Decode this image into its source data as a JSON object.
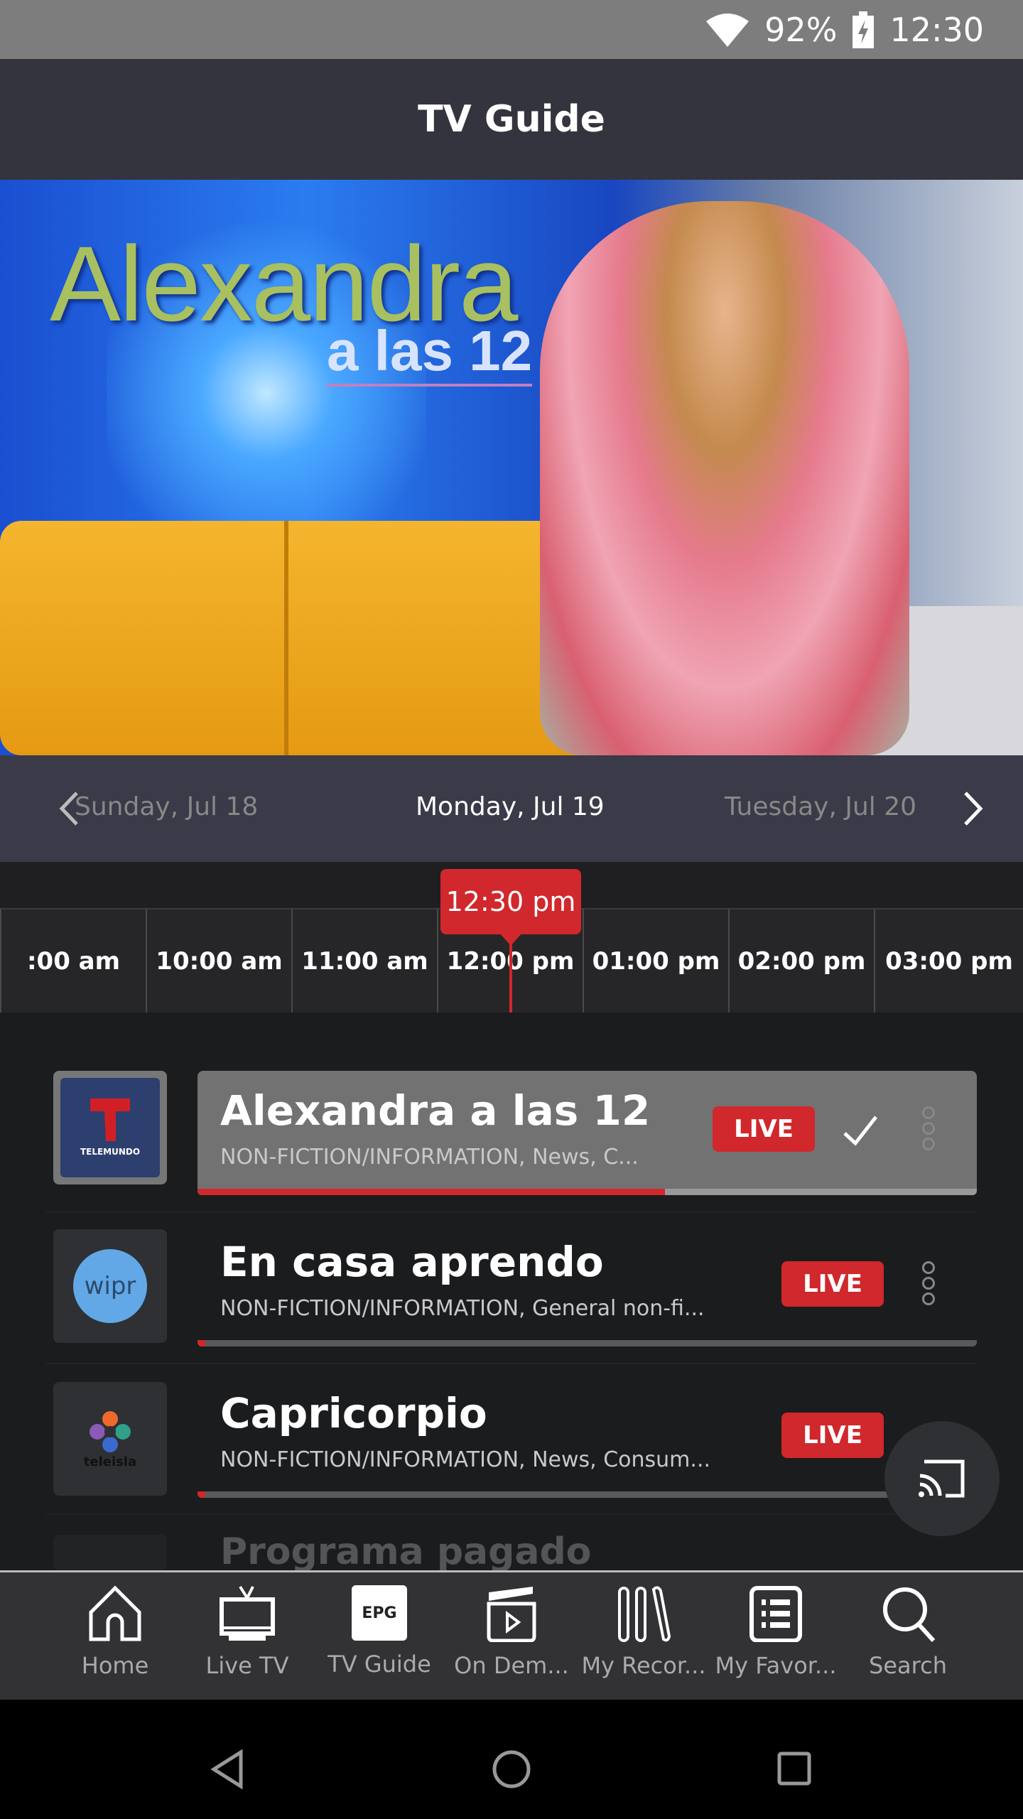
{
  "status_bar": {
    "battery": "92%",
    "time": "12:30",
    "icons": [
      "wifi-icon",
      "battery-charging-icon"
    ]
  },
  "header": {
    "title": "TV Guide"
  },
  "hero": {
    "show_logo_text": "Alexandra",
    "show_logo_subtext": "a las 12"
  },
  "date_nav": {
    "prev": "Sunday, Jul 18",
    "current": "Monday, Jul 19",
    "next": "Tuesday, Jul 20"
  },
  "timeline": {
    "now_label": "12:30 pm",
    "slots": [
      ":00 am",
      "10:00 am",
      "11:00 am",
      "12:00 pm",
      "01:00 pm",
      "02:00 pm",
      "03:00 pm"
    ]
  },
  "programs": [
    {
      "channel": "TELEMUNDO",
      "title": "Alexandra a las 12",
      "subtitle": "NON-FICTION/INFORMATION, News, C...",
      "badge": "LIVE",
      "progress": 0.6,
      "selected": true,
      "checked": true
    },
    {
      "channel": "wipr",
      "title": "En casa aprendo",
      "subtitle": "NON-FICTION/INFORMATION, General non-fi...",
      "badge": "LIVE",
      "progress": 0.01
    },
    {
      "channel": "teleisla",
      "title": "Capricorpio",
      "subtitle": "NON-FICTION/INFORMATION, News, Consum...",
      "badge": "LIVE",
      "progress": 0.01
    },
    {
      "title": "Programa pagado"
    }
  ],
  "bottom_nav": [
    {
      "label": "Home",
      "icon": "home-icon"
    },
    {
      "label": "Live TV",
      "icon": "tv-icon"
    },
    {
      "label": "TV Guide",
      "icon": "epg-icon",
      "icon_text": "EPG",
      "active": true
    },
    {
      "label": "On Dem...",
      "icon": "on-demand-icon"
    },
    {
      "label": "My Recor...",
      "icon": "recordings-icon"
    },
    {
      "label": "My Favor...",
      "icon": "favorites-list-icon"
    },
    {
      "label": "Search",
      "icon": "search-icon"
    }
  ],
  "colors": {
    "accent": "#d0282c",
    "header": "#34343f",
    "background": "#1b1c1e"
  }
}
